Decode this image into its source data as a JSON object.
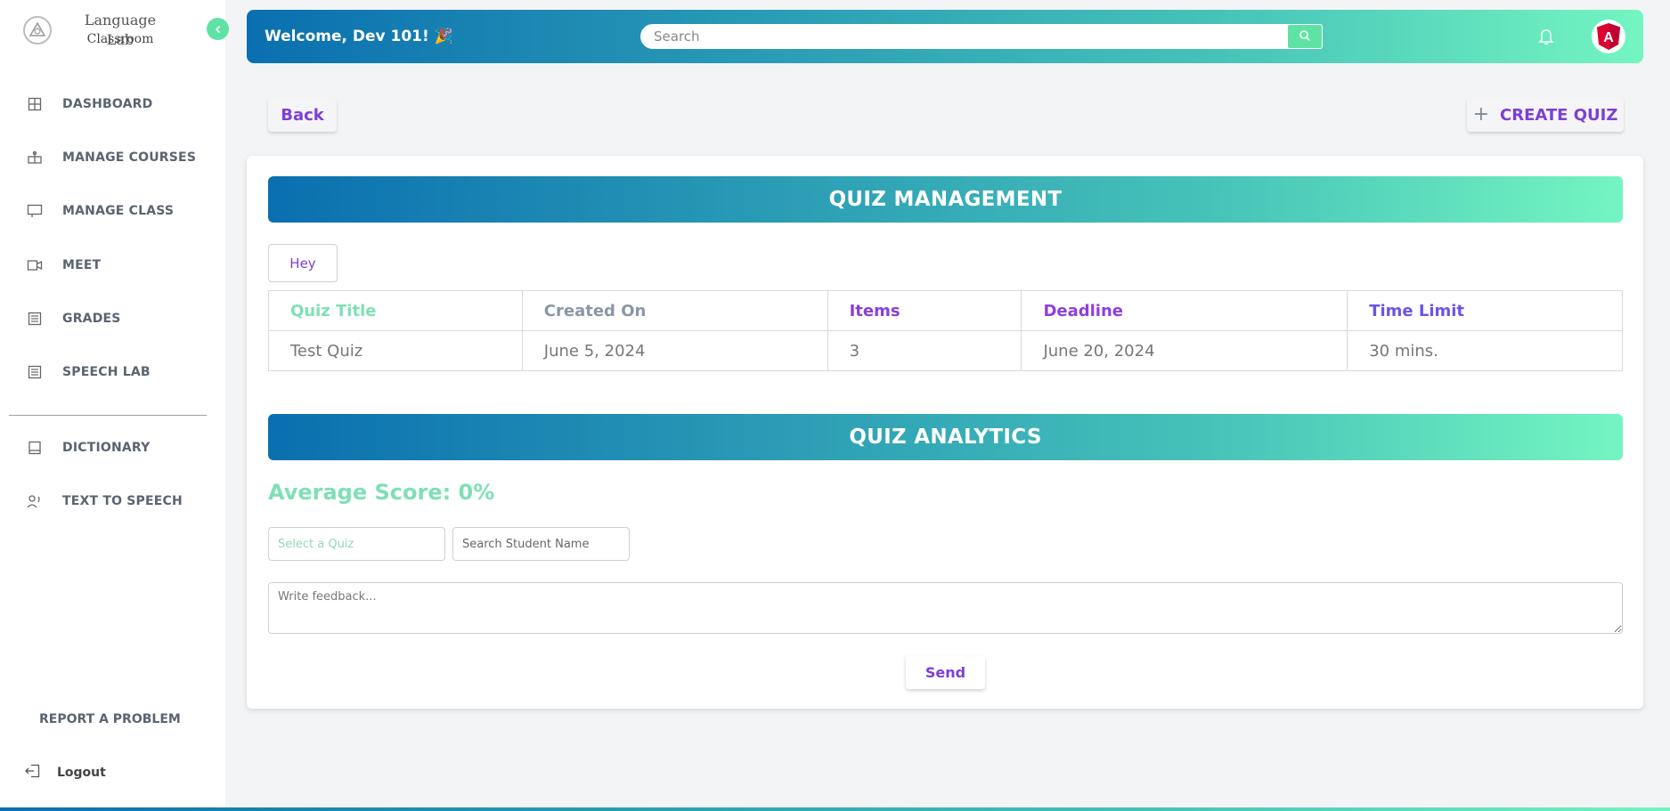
{
  "sidebar": {
    "brand_title": "Language Lab",
    "brand_subtitle": "Classroom",
    "items": [
      {
        "label": "DASHBOARD",
        "icon": "grid-icon"
      },
      {
        "label": "MANAGE COURSES",
        "icon": "courses-icon"
      },
      {
        "label": "MANAGE CLASS",
        "icon": "class-icon"
      },
      {
        "label": "MEET",
        "icon": "video-icon"
      },
      {
        "label": "GRADES",
        "icon": "list-icon"
      },
      {
        "label": "SPEECH LAB",
        "icon": "list-icon"
      },
      {
        "label": "DICTIONARY",
        "icon": "book-icon"
      },
      {
        "label": "TEXT TO SPEECH",
        "icon": "speaker-person-icon"
      }
    ],
    "report_label": "REPORT A PROBLEM",
    "logout_label": "Logout"
  },
  "header": {
    "welcome": "Welcome, Dev 101! 🎉",
    "search_placeholder": "Search",
    "avatar_letter": "A"
  },
  "actions": {
    "back_label": "Back",
    "create_label": "CREATE QUIZ"
  },
  "quiz_management": {
    "title": "QUIZ MANAGEMENT",
    "hey_label": "Hey",
    "columns": [
      "Quiz Title",
      "Created On",
      "Items",
      "Deadline",
      "Time Limit"
    ],
    "rows": [
      [
        "Test Quiz",
        "June 5, 2024",
        "3",
        "June 20, 2024",
        "30 mins."
      ]
    ]
  },
  "quiz_analytics": {
    "title": "QUIZ ANALYTICS",
    "average_score": "Average Score: 0%",
    "select_quiz_placeholder": "Select a Quiz",
    "search_student_placeholder": "Search Student Name",
    "feedback_placeholder": "Write feedback...",
    "send_label": "Send"
  },
  "colors": {
    "accent_purple": "#7e3ed8",
    "accent_green": "#5ee3a5",
    "gradient_start": "#0a6fb0",
    "gradient_end": "#74f5c1",
    "header_col_1": "#7fe0b5",
    "header_col_2": "#8a96a6",
    "header_col_3": "#8a3fd9",
    "header_col_4": "#8f3ee0",
    "header_col_5": "#6b55e6"
  }
}
